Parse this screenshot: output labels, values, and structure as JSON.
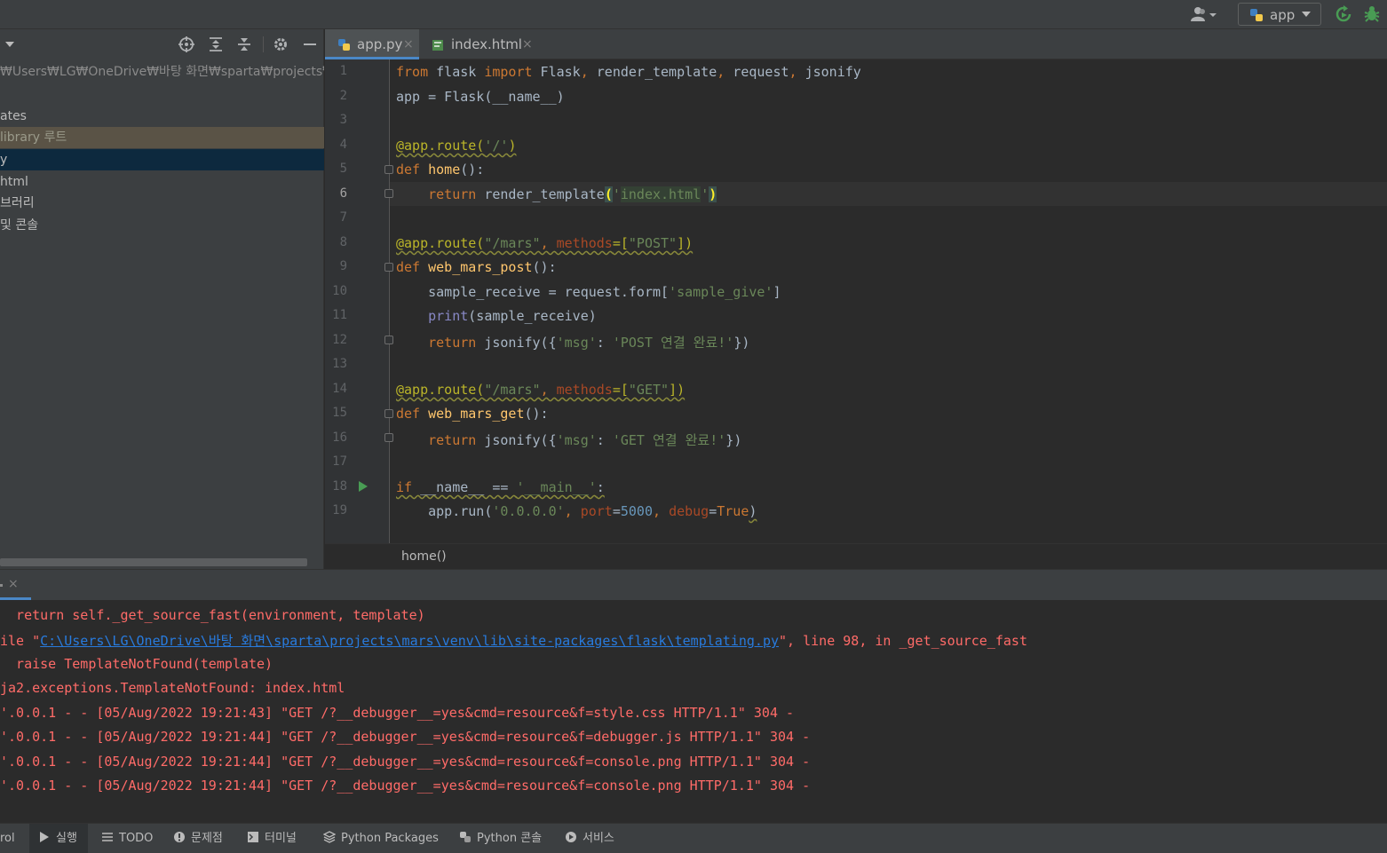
{
  "toolbar": {
    "run_config": "app",
    "icons": [
      "user-icon",
      "python-icon",
      "rerun-icon",
      "debug-bug-icon"
    ]
  },
  "project": {
    "path": "₩Users₩LG₩OneDrive₩바탕 화면₩sparta₩projects₩ma",
    "items": [
      {
        "label": "ates",
        "state": "normal"
      },
      {
        "label": "library 루트",
        "state": "library"
      },
      {
        "label": "y",
        "state": "selected"
      },
      {
        "label": "html",
        "state": "normal"
      },
      {
        "label": "브러리",
        "state": "normal"
      },
      {
        "label": " 및 콘솔",
        "state": "normal"
      }
    ]
  },
  "tabs": [
    {
      "label": "app.py",
      "active": true,
      "close": "×"
    },
    {
      "label": "index.html",
      "active": false,
      "close": "×"
    }
  ],
  "editor": {
    "line_numbers": [
      "1",
      "2",
      "3",
      "4",
      "5",
      "6",
      "7",
      "8",
      "9",
      "10",
      "11",
      "12",
      "13",
      "14",
      "15",
      "16",
      "17",
      "18",
      "19"
    ],
    "current_line": "6"
  },
  "breadcrumb": "home()",
  "console_close": "×",
  "console": {
    "lines": [
      {
        "kind": "err",
        "text": "  return self._get_source_fast(environment, template)"
      },
      {
        "kind": "file",
        "pre": "ile \"",
        "link": "C:\\Users\\LG\\OneDrive\\바탕 화면\\sparta\\projects\\mars\\venv\\lib\\site-packages\\flask\\templating.py",
        "post": "\", line 98, in _get_source_fast"
      },
      {
        "kind": "err",
        "text": "  raise TemplateNotFound(template)"
      },
      {
        "kind": "err",
        "text": "ja2.exceptions.TemplateNotFound: index.html"
      },
      {
        "kind": "log",
        "text": "'.0.0.1 - - [05/Aug/2022 19:21:43] \"GET /?__debugger__=yes&cmd=resource&f=style.css HTTP/1.1\" 304 -"
      },
      {
        "kind": "log",
        "text": "'.0.0.1 - - [05/Aug/2022 19:21:44] \"GET /?__debugger__=yes&cmd=resource&f=debugger.js HTTP/1.1\" 304 -"
      },
      {
        "kind": "log",
        "text": "'.0.0.1 - - [05/Aug/2022 19:21:44] \"GET /?__debugger__=yes&cmd=resource&f=console.png HTTP/1.1\" 304 -"
      },
      {
        "kind": "log",
        "text": "'.0.0.1 - - [05/Aug/2022 19:21:44] \"GET /?__debugger__=yes&cmd=resource&f=console.png HTTP/1.1\" 304 -"
      }
    ]
  },
  "bottom_tabs": [
    {
      "label": "rol",
      "icon": "none"
    },
    {
      "label": "실행",
      "icon": "run-icon",
      "active": true
    },
    {
      "label": "TODO",
      "icon": "todo-icon"
    },
    {
      "label": "문제점",
      "icon": "problems-icon"
    },
    {
      "label": "터미널",
      "icon": "terminal-icon"
    },
    {
      "label": "Python Packages",
      "icon": "packages-icon"
    },
    {
      "label": "Python 콘솔",
      "icon": "python-console-icon"
    },
    {
      "label": "서비스",
      "icon": "services-icon"
    }
  ],
  "colors": {
    "accent": "#4a88c7",
    "keyword": "#cc7832",
    "string": "#6a8759",
    "decorator": "#bbb529",
    "function": "#ffc66d",
    "number": "#6897bb",
    "error": "#ff6b68",
    "link": "#287bde"
  }
}
